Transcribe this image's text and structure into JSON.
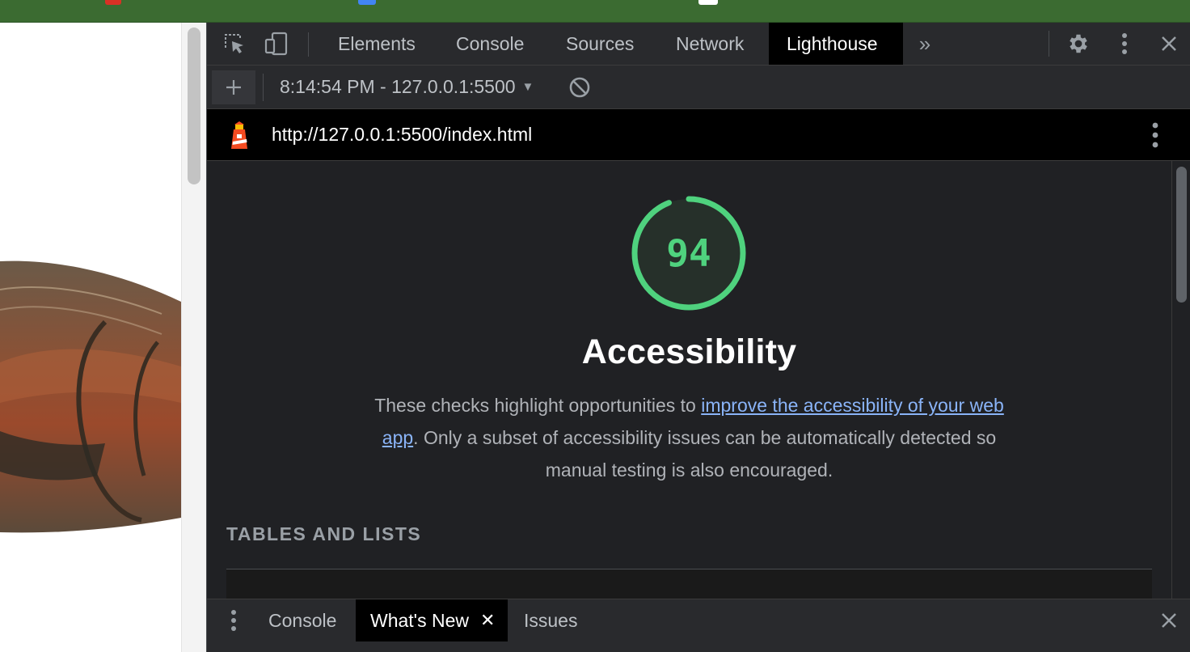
{
  "colors": {
    "accent_score": "#4fd27e",
    "link": "#8ab4f8",
    "browser_frame": "#3b6b31"
  },
  "devtools": {
    "tabs": [
      {
        "label": "Elements",
        "active": false
      },
      {
        "label": "Console",
        "active": false
      },
      {
        "label": "Sources",
        "active": false
      },
      {
        "label": "Network",
        "active": false
      },
      {
        "label": "Lighthouse",
        "active": true
      }
    ],
    "toolbar_icons": [
      "inspect-element-icon",
      "device-toolbar-icon",
      "more-tabs-icon",
      "settings-gear-icon",
      "kebab-menu-icon",
      "close-icon"
    ]
  },
  "lighthouse": {
    "report_selector": "8:14:54 PM - 127.0.0.1:5500",
    "url": "http://127.0.0.1:5500/index.html",
    "score": "94",
    "score_fraction": 0.94,
    "category_title": "Accessibility",
    "description_before": "These checks highlight opportunities to ",
    "description_link": "improve the accessibility of your web app",
    "description_after": ". Only a subset of accessibility issues can be automatically detected so manual testing is also encouraged.",
    "group_title": "TABLES AND LISTS"
  },
  "drawer": {
    "tabs": [
      {
        "label": "Console",
        "active": false
      },
      {
        "label": "What's New",
        "active": true,
        "closable": true
      },
      {
        "label": "Issues",
        "active": false
      }
    ]
  }
}
